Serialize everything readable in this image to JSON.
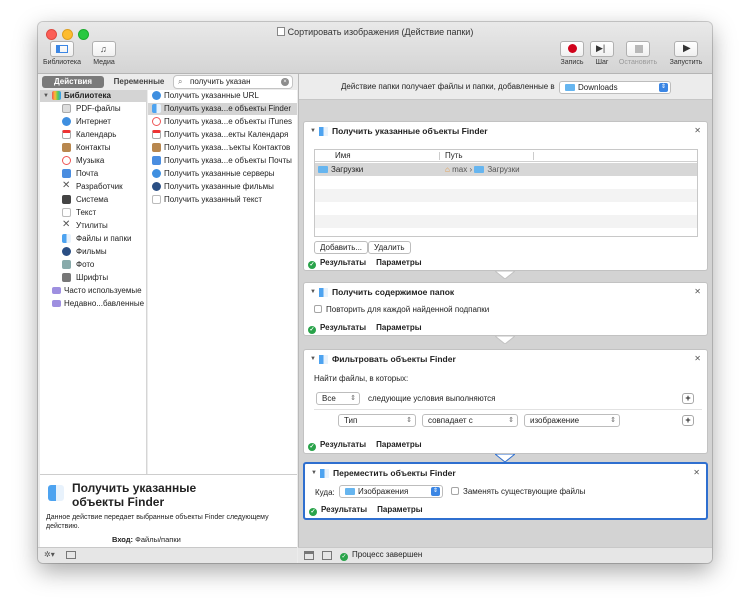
{
  "window": {
    "title": "Сортировать изображения (Действие папки)"
  },
  "toolbar": {
    "library_label": "Библиотека",
    "media_label": "Медиа",
    "record_label": "Запись",
    "step_label": "Шаг",
    "stop_label": "Остановить",
    "run_label": "Запустить"
  },
  "tabs": {
    "actions": "Действия",
    "variables": "Переменные"
  },
  "search": {
    "value": "получить указан"
  },
  "library": {
    "items": [
      {
        "label": "Библиотека"
      },
      {
        "label": "PDF-файлы"
      },
      {
        "label": "Интернет"
      },
      {
        "label": "Календарь"
      },
      {
        "label": "Контакты"
      },
      {
        "label": "Музыка"
      },
      {
        "label": "Почта"
      },
      {
        "label": "Разработчик"
      },
      {
        "label": "Система"
      },
      {
        "label": "Текст"
      },
      {
        "label": "Утилиты"
      },
      {
        "label": "Файлы и папки"
      },
      {
        "label": "Фильмы"
      },
      {
        "label": "Фото"
      },
      {
        "label": "Шрифты"
      },
      {
        "label": "Часто используемые"
      },
      {
        "label": "Недавно...бавленные"
      }
    ]
  },
  "results": {
    "items": [
      {
        "label": "Получить указанные URL"
      },
      {
        "label": "Получить указа...е объекты Finder"
      },
      {
        "label": "Получить указа...е объекты iTunes"
      },
      {
        "label": "Получить указа...екты Календаря"
      },
      {
        "label": "Получить указа...ъекты Контактов"
      },
      {
        "label": "Получить указа...е объекты Почты"
      },
      {
        "label": "Получить указанные серверы"
      },
      {
        "label": "Получить указанные фильмы"
      },
      {
        "label": "Получить указанный текст"
      }
    ]
  },
  "description": {
    "title": "Получить указанные объекты Finder",
    "text": "Данное действие передает выбранные объекты Finder следующему действию.",
    "input_label": "Вход:",
    "input_value": "Файлы/папки"
  },
  "workflow": {
    "receives_label": "Действие папки получает файлы и папки, добавленные в",
    "receives_folder": "Downloads",
    "results_label": "Результаты",
    "options_label": "Параметры",
    "status": "Процесс завершен",
    "action1": {
      "title": "Получить указанные объекты Finder",
      "col_name": "Имя",
      "col_path": "Путь",
      "row_name": "Загрузки",
      "row_path_user": "max",
      "row_path_folder": "Загрузки",
      "add_button": "Добавить...",
      "remove_button": "Удалить"
    },
    "action2": {
      "title": "Получить содержимое папок",
      "repeat_label": "Повторить для каждой найденной подпапки"
    },
    "action3": {
      "title": "Фильтровать объекты Finder",
      "find_label": "Найти файлы, в которых:",
      "match_value": "Все",
      "match_suffix": "следующие условия выполняются",
      "criterion_field": "Тип",
      "criterion_op": "совпадает с",
      "criterion_value": "изображение"
    },
    "action4": {
      "title": "Переместить объекты Finder",
      "to_label": "Куда:",
      "to_folder": "Изображения",
      "replace_label": "Заменять существующие файлы"
    }
  },
  "colors": {
    "accent": "#2f6fcf",
    "record": "#d0021b",
    "ok": "#29a34a",
    "selection": "#d4d4d4"
  }
}
